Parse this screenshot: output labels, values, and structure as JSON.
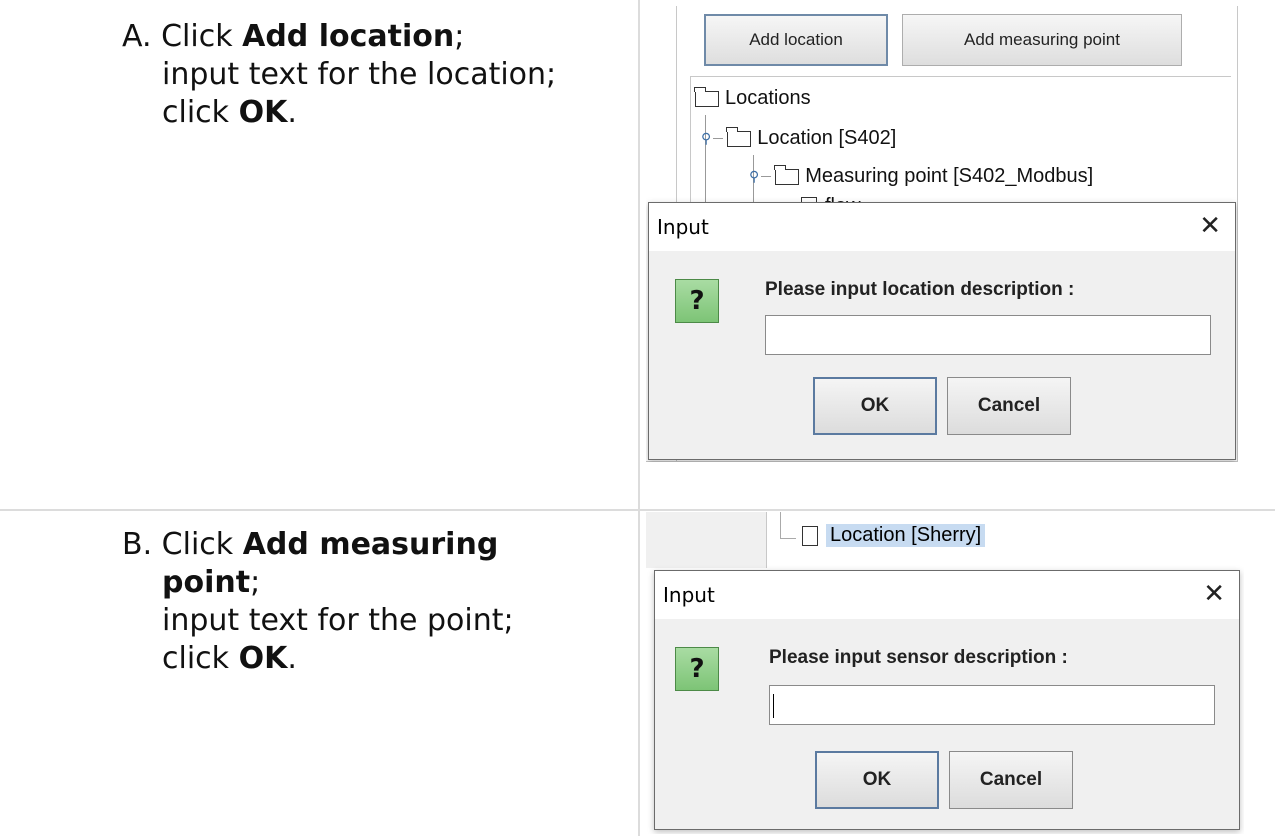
{
  "step_a": {
    "letter": "A.",
    "click_word": "Click",
    "action": "Add location",
    "semicolon": ";",
    "line2": "input text for the location;",
    "line3_prefix": "click",
    "ok": "OK",
    "period": "."
  },
  "step_b": {
    "letter": "B.",
    "click_word": "Click",
    "action_line1": "Add measuring",
    "action_line2": "point",
    "semicolon": ";",
    "line2": "input text for the point;",
    "line3_prefix": "click",
    "ok": "OK",
    "period": "."
  },
  "shot_a": {
    "toolbar": {
      "add_location": "Add location",
      "add_measuring_point": "Add measuring point"
    },
    "tree": {
      "root": "Locations",
      "location": "Location [S402]",
      "measuring_point": "Measuring point [S402_Modbus]",
      "child_partial": "flow"
    },
    "dialog": {
      "title": "Input",
      "close_glyph": "✕",
      "icon_glyph": "?",
      "prompt": "Please input location description :",
      "input_value": "",
      "ok": "OK",
      "cancel": "Cancel"
    }
  },
  "shot_b": {
    "tree": {
      "selected_node": "Location [Sherry]"
    },
    "dialog": {
      "title": "Input",
      "close_glyph": "✕",
      "icon_glyph": "?",
      "prompt": "Please input sensor description :",
      "input_value": "",
      "ok": "OK",
      "cancel": "Cancel"
    }
  }
}
